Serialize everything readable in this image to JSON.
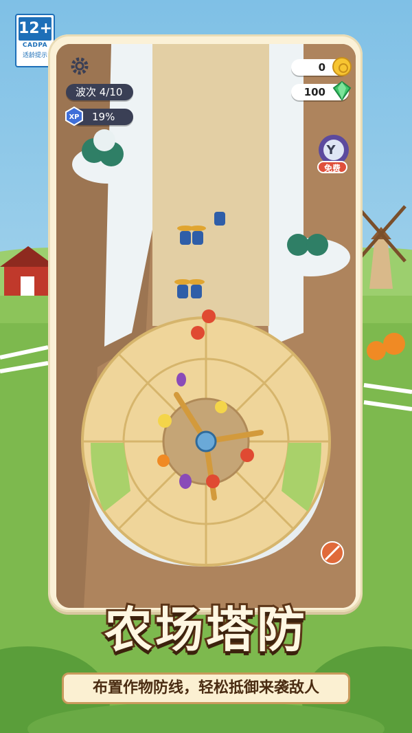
{
  "age_rating": {
    "number": "12+",
    "org": "CADPA",
    "caption": "适龄提示"
  },
  "hud": {
    "coins": "0",
    "gems": "100",
    "wave": "波次 4/10",
    "xp_label": "XP",
    "xp_percent": "19%",
    "free_label": "免费"
  },
  "title": "农场塔防",
  "subtitle": "布置作物防线，轻松抵御来袭敌人",
  "colors": {
    "path": "#e9d7b0",
    "field": "#f3d9a0",
    "grass": "#a9d16a",
    "frame": "#fbf1d7",
    "wood": "#8b5a2b"
  },
  "icons": [
    "gear-icon",
    "coin-icon",
    "gem-icon",
    "xp-icon",
    "speed-ticket-icon",
    "no-ads-icon"
  ]
}
